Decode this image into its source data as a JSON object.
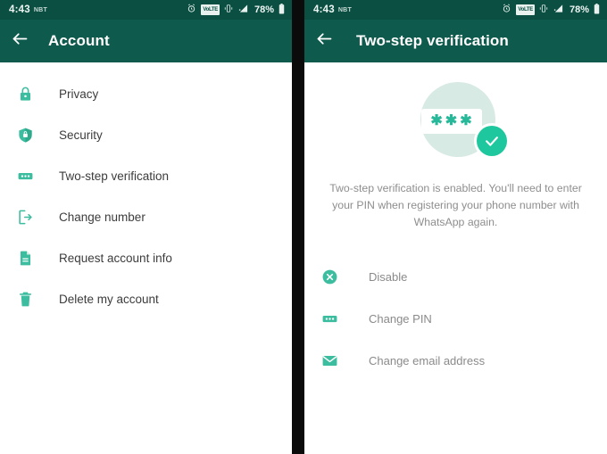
{
  "accent": "#3dbd9f",
  "appbar_color": "#0e5b4e",
  "statusbar_color": "#0b4f43",
  "check_color": "#1ec79d",
  "hero_circle_color": "#d8eae4",
  "statusbar": {
    "time": "4:43",
    "timezone": "NBT",
    "battery_percent": "78%",
    "icons": [
      "alarm-icon",
      "volte-icon",
      "vibrate-icon",
      "signal-icon",
      "battery-icon"
    ],
    "volte_label": "VoLTE"
  },
  "left": {
    "appbar": {
      "title": "Account",
      "back_icon": "back-arrow-icon"
    },
    "items": [
      {
        "label": "Privacy",
        "icon": "lock-icon"
      },
      {
        "label": "Security",
        "icon": "shield-icon"
      },
      {
        "label": "Two-step verification",
        "icon": "pin-dots-icon"
      },
      {
        "label": "Change number",
        "icon": "change-number-icon"
      },
      {
        "label": "Request account info",
        "icon": "document-icon"
      },
      {
        "label": "Delete my account",
        "icon": "trash-icon"
      }
    ]
  },
  "right": {
    "appbar": {
      "title": "Two-step verification",
      "back_icon": "back-arrow-icon"
    },
    "hero": {
      "pin_stars": "✱✱✱",
      "badge_icon": "check-circle-icon",
      "card_icon": "pin-card-icon"
    },
    "description": "Two-step verification is enabled. You'll need to enter your PIN when registering your phone number with WhatsApp again.",
    "actions": [
      {
        "label": "Disable",
        "icon": "close-circle-icon"
      },
      {
        "label": "Change PIN",
        "icon": "pin-dots-icon"
      },
      {
        "label": "Change email address",
        "icon": "envelope-icon"
      }
    ]
  }
}
